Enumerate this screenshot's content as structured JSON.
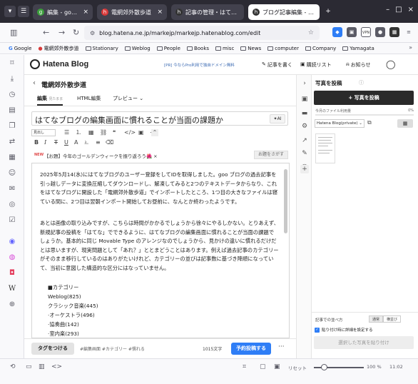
{
  "browser": {
    "tabs": [
      {
        "title": "編集 - goo blog",
        "color": "#3c9f3c",
        "active": false
      },
      {
        "title": "電網郊外散歩道",
        "color": "#d93a3a",
        "active": false
      },
      {
        "title": "記事の管理・はてなブログ",
        "color": "#333333",
        "active": false
      },
      {
        "title": "ブログ記事編集 - はてなブ",
        "color": "#333333",
        "active": true
      }
    ],
    "url": "blog.hatena.ne.jp/markejp/markejp.hatenablog.com/edit",
    "bookmarks": [
      "Google",
      "電網郊外散歩道",
      "Stationary",
      "Weblog",
      "People",
      "Books",
      "misc",
      "News",
      "computer",
      "Company",
      "Yamagata"
    ]
  },
  "header": {
    "logo": "Hatena Blog",
    "promo": "[PR] 今ならPro利用で独自ドメイン無料",
    "write": "記事を書く",
    "reading": "購読リスト",
    "notifications": "お知らせ"
  },
  "editor": {
    "blog_name": "電網郊外散歩道",
    "modes": {
      "edit": "編集",
      "edit_sub": "見たまま",
      "html": "HTML編集",
      "preview": "プレビュー"
    },
    "title": "はてなブログの編集画面に慣れることが当面の課題か",
    "ai_label": "AI",
    "size_label": "見出し",
    "theme_new": "NEW",
    "theme_text": "【お題】今年のゴールデンウィークを振り返ろう🌺 ×",
    "theme_button": "お題をさがす",
    "paragraph1": "2025年5月14(水)にはてなブログのユーザー登録をしてIDを取得しました。goo ブログの過去記事を引っ越しデータに変換圧縮してダウンロードし、解凍してみると2つのテキストデータからなり、これをはてなブログに開設した「電網郊外散歩道」でインポートしたところ、1つ目の大きなファイルは寝ている間に、2つ目は翌朝インポート開始してお昼前に、なんとか終わったようです。",
    "paragraph2": "あとは画像の取り込みですが、こちらは時間がかかるでしょうから徐々にやるしかない。とりあえず、新規記事の投稿を「はてな」でできるように、はてなブログの編集画面に慣れることが当面の課題でしょうか。基本的に同じ Movable Type のアレンジなのでしょうから、見かけの違いに慣れるだけだとは思いますが、現実問題として「あれ？」ととまどうことはあります。例えば過去記事のカテゴリーがそのまま移行しているのはありがたいけれど、カテゴリーの並びは記事数に基づき降順になっていて、当初に意図した構造的な区分にはなっていません。",
    "list": [
      "■カテゴリー",
      "Weblog(825)",
      "クラシック音楽(445)",
      "·オーケストラ(496)",
      "·協奏曲(142)",
      "·室内楽(293)"
    ],
    "tag_button": "タグをつける",
    "tags": "#編集画面 #カテゴリー #慣れる",
    "char_count": "1015文字",
    "publish": "予約投稿する"
  },
  "photo_panel": {
    "title": "写真を投稿",
    "upload": "+ 写真を投稿",
    "quota_label": "今月のファイル利用量",
    "quota_pct": "0%",
    "quota_fraction": 0.0,
    "album": "Hatena Blog(private)",
    "order_label": "記事での並べ方",
    "order_options": [
      "通常",
      "横並び"
    ],
    "detail_label": "貼り付け時に詳細を設定する",
    "paste_button": "選択した写真を貼り付け"
  },
  "status": {
    "reset": "リセット",
    "zoom": "100 %",
    "zoom_fraction": 0.2,
    "time": "11:02"
  }
}
